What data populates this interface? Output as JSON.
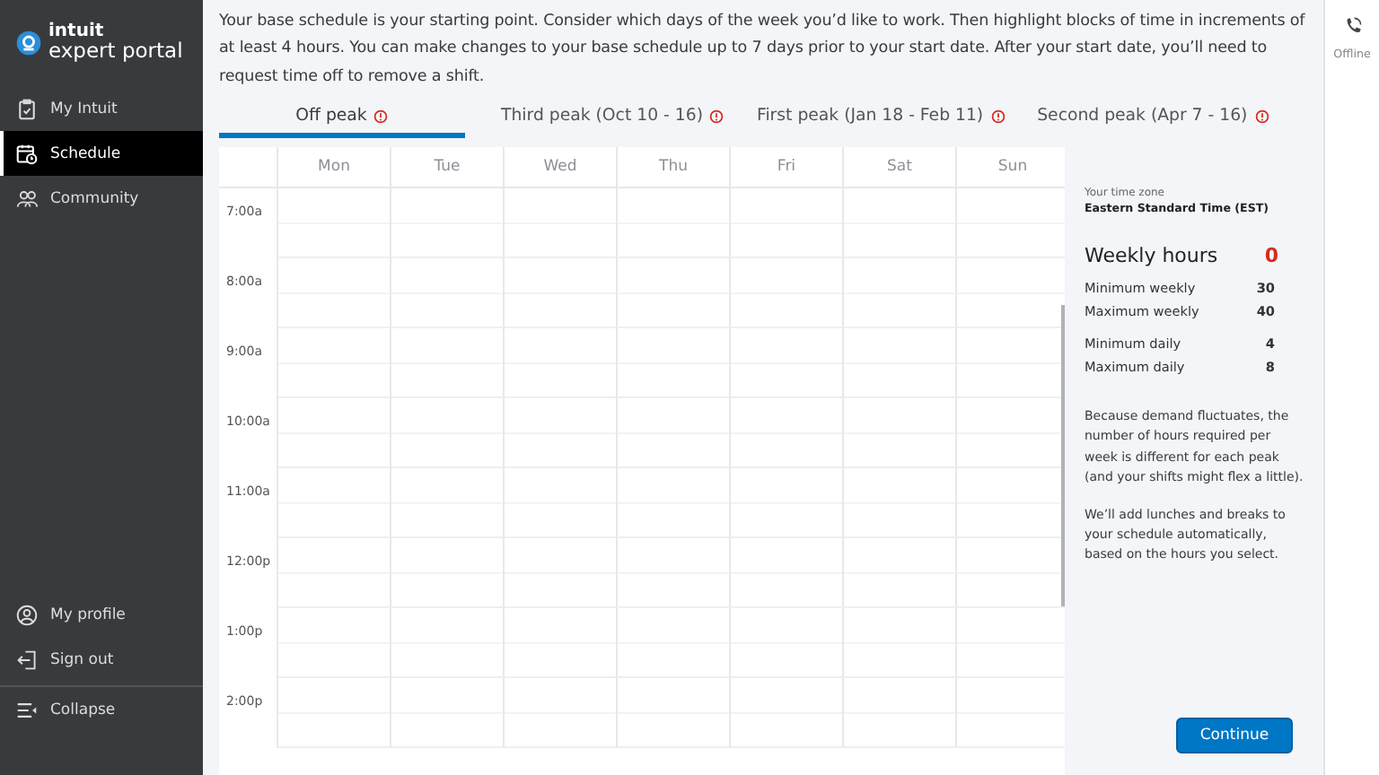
{
  "brand": {
    "line1": "intuit",
    "line2": "expert portal"
  },
  "sidebar": {
    "items": [
      {
        "label": "My Intuit",
        "selected": false
      },
      {
        "label": "Schedule",
        "selected": true
      },
      {
        "label": "Community",
        "selected": false
      }
    ],
    "bottom_items": [
      {
        "label": "My profile"
      },
      {
        "label": "Sign out"
      }
    ],
    "collapse": "Collapse"
  },
  "intro": "Your base schedule is your starting point. Consider which days of the week you’d like to work. Then highlight blocks of time in increments of at least 4 hours. You can make changes to your base schedule up to 7 days prior to your start date. After your start date, you’ll need to request time off to remove a shift.",
  "tabs": [
    {
      "label": "Off peak",
      "selected": true
    },
    {
      "label": "Third peak (Oct 10 - 16)",
      "selected": false
    },
    {
      "label": "First peak (Jan 18 - Feb 11)",
      "selected": false
    },
    {
      "label": "Second peak (Apr 7 - 16)",
      "selected": false
    }
  ],
  "calendar": {
    "days": [
      "Mon",
      "Tue",
      "Wed",
      "Thu",
      "Fri",
      "Sat",
      "Sun"
    ],
    "times": [
      "7:00a",
      "8:00a",
      "9:00a",
      "10:00a",
      "11:00a",
      "12:00p",
      "1:00p",
      "2:00p"
    ]
  },
  "panel": {
    "timezone_label": "Your time zone",
    "timezone": "Eastern Standard Time (EST)",
    "weekly_hours_label": "Weekly hours",
    "weekly_hours": "0",
    "limits": [
      [
        {
          "label": "Minimum weekly",
          "value": "30"
        },
        {
          "label": "Maximum weekly",
          "value": "40"
        }
      ],
      [
        {
          "label": "Minimum daily",
          "value": "4"
        },
        {
          "label": "Maximum daily",
          "value": "8"
        }
      ]
    ],
    "notes": [
      "Because demand fluctuates, the number of hours required per week is different for each peak (and your shifts might flex a little).",
      "We’ll add lunches and breaks to your schedule automatically, based on the hours you select."
    ],
    "button": "Continue"
  },
  "status": {
    "label": "Offline"
  }
}
